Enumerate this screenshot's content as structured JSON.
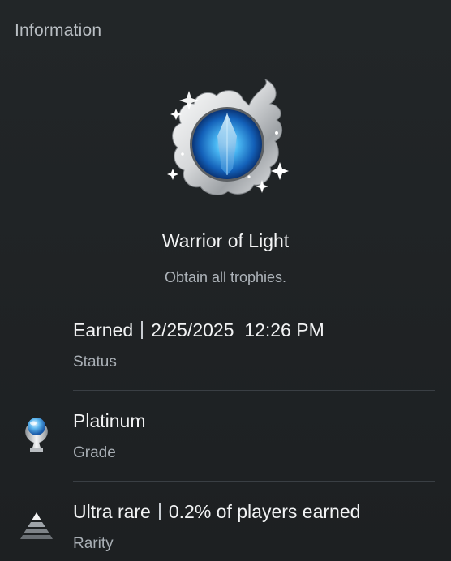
{
  "header": {
    "title": "Information"
  },
  "trophy": {
    "name": "Warrior of Light",
    "description": "Obtain all trophies.",
    "art_icon": "crystal-emblem-icon"
  },
  "status": {
    "earned_label": "Earned",
    "date": "2/25/2025",
    "time": "12:26 PM",
    "caption": "Status"
  },
  "grade": {
    "value": "Platinum",
    "caption": "Grade",
    "icon": "platinum-trophy-icon"
  },
  "rarity": {
    "value": "Ultra rare",
    "detail": "0.2% of players earned",
    "caption": "Rarity",
    "icon": "rarity-pyramid-icon"
  },
  "colors": {
    "background": "#1f2224",
    "primary_text": "#f2f3f4",
    "secondary_text": "#a9afb5",
    "divider": "#3a3f44"
  }
}
